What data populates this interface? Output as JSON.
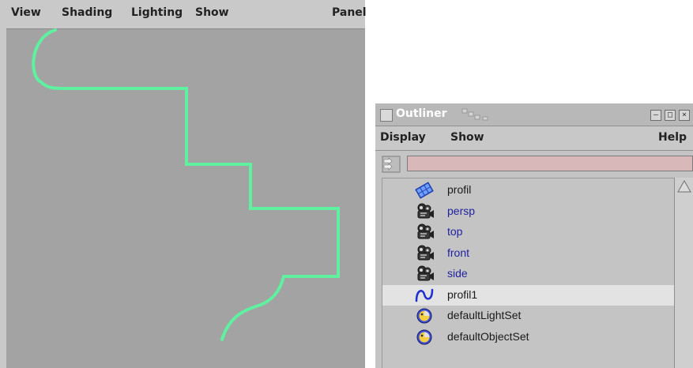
{
  "viewport": {
    "menu": [
      "View",
      "Shading",
      "Lighting",
      "Show",
      "Panel"
    ],
    "curve_color": "#5ff0a0",
    "background": "#a3a3a3"
  },
  "outliner": {
    "title": "Outliner",
    "window_buttons": [
      "minimize",
      "maximize",
      "close"
    ],
    "menu": {
      "display": "Display",
      "show": "Show",
      "help": "Help"
    },
    "filter": {
      "value": "",
      "placeholder": ""
    },
    "items": [
      {
        "label": "profil",
        "icon": "nurbs-surface-icon",
        "color": "#1a1a1a",
        "selected": false
      },
      {
        "label": "persp",
        "icon": "camera-icon",
        "color": "#1f1fa0",
        "selected": false
      },
      {
        "label": "top",
        "icon": "camera-icon",
        "color": "#1f1fa0",
        "selected": false
      },
      {
        "label": "front",
        "icon": "camera-icon",
        "color": "#1f1fa0",
        "selected": false
      },
      {
        "label": "side",
        "icon": "camera-icon",
        "color": "#1f1fa0",
        "selected": false
      },
      {
        "label": "profil1",
        "icon": "nurbs-curve-icon",
        "color": "#1a1a1a",
        "selected": true
      },
      {
        "label": "defaultLightSet",
        "icon": "set-icon",
        "color": "#1a1a1a",
        "selected": false
      },
      {
        "label": "defaultObjectSet",
        "icon": "set-icon",
        "color": "#1a1a1a",
        "selected": false
      }
    ]
  }
}
